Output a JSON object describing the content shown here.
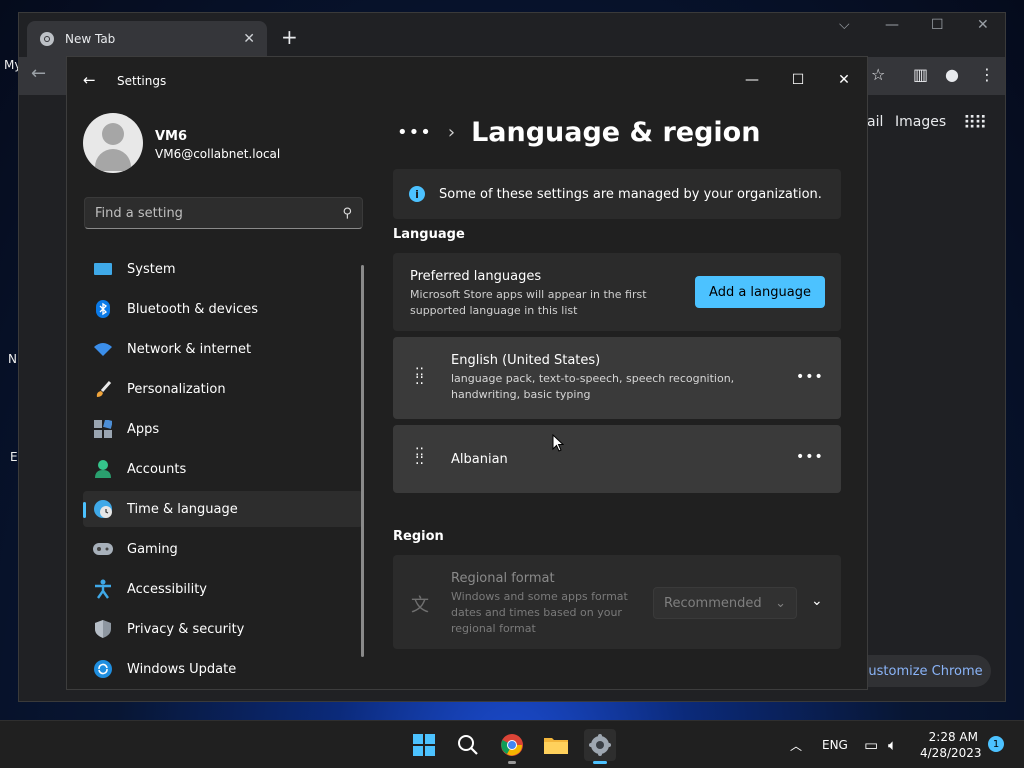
{
  "desktop": {
    "icon_labels": [
      "My",
      "N",
      "E"
    ]
  },
  "chrome": {
    "tab_title": "New Tab",
    "new_tab_symbol": "+",
    "links": [
      "ail",
      "Images"
    ],
    "customize_label": "Customize Chrome"
  },
  "settings": {
    "title": "Settings",
    "profile": {
      "name": "VM6",
      "email": "VM6@collabnet.local"
    },
    "search": {
      "placeholder": "Find a setting"
    },
    "nav": [
      {
        "label": "System",
        "icon": "monitor-icon"
      },
      {
        "label": "Bluetooth & devices",
        "icon": "bluetooth-icon"
      },
      {
        "label": "Network & internet",
        "icon": "wifi-icon"
      },
      {
        "label": "Personalization",
        "icon": "brush-icon"
      },
      {
        "label": "Apps",
        "icon": "apps-icon"
      },
      {
        "label": "Accounts",
        "icon": "person-icon"
      },
      {
        "label": "Time & language",
        "icon": "clock-globe-icon",
        "active": true
      },
      {
        "label": "Gaming",
        "icon": "gamepad-icon"
      },
      {
        "label": "Accessibility",
        "icon": "accessibility-icon"
      },
      {
        "label": "Privacy & security",
        "icon": "shield-icon"
      },
      {
        "label": "Windows Update",
        "icon": "update-icon"
      }
    ],
    "page": {
      "breadcrumb_more": "•••",
      "title": "Language & region",
      "info_text": "Some of these settings are managed by your organization.",
      "language_heading": "Language",
      "preferred": {
        "title": "Preferred languages",
        "description": "Microsoft Store apps will appear in the first supported language in this list",
        "add_button": "Add a language"
      },
      "languages": [
        {
          "name": "English (United States)",
          "description": "language pack, text-to-speech, speech recognition, handwriting, basic typing"
        },
        {
          "name": "Albanian",
          "description": ""
        }
      ],
      "region_heading": "Region",
      "regional_format": {
        "title": "Regional format",
        "description": "Windows and some apps format dates and times based on your regional format",
        "selected": "Recommended"
      }
    }
  },
  "taskbar": {
    "language": "ENG",
    "time": "2:28 AM",
    "date": "4/28/2023",
    "notification_count": "1"
  }
}
